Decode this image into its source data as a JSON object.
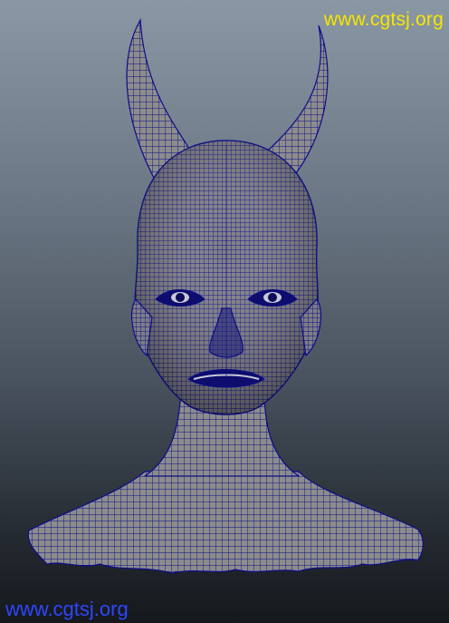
{
  "viewport": {
    "watermark_top": "www.cgtsj.org",
    "watermark_bottom": "www.cgtsj.org",
    "model": {
      "subject": "horned-bust-wireframe",
      "mesh_color": "#0c0c8a",
      "surface_color": "#8a8a8a"
    },
    "background": {
      "top_color": "#8a97a4",
      "bottom_color": "#15181c"
    }
  }
}
